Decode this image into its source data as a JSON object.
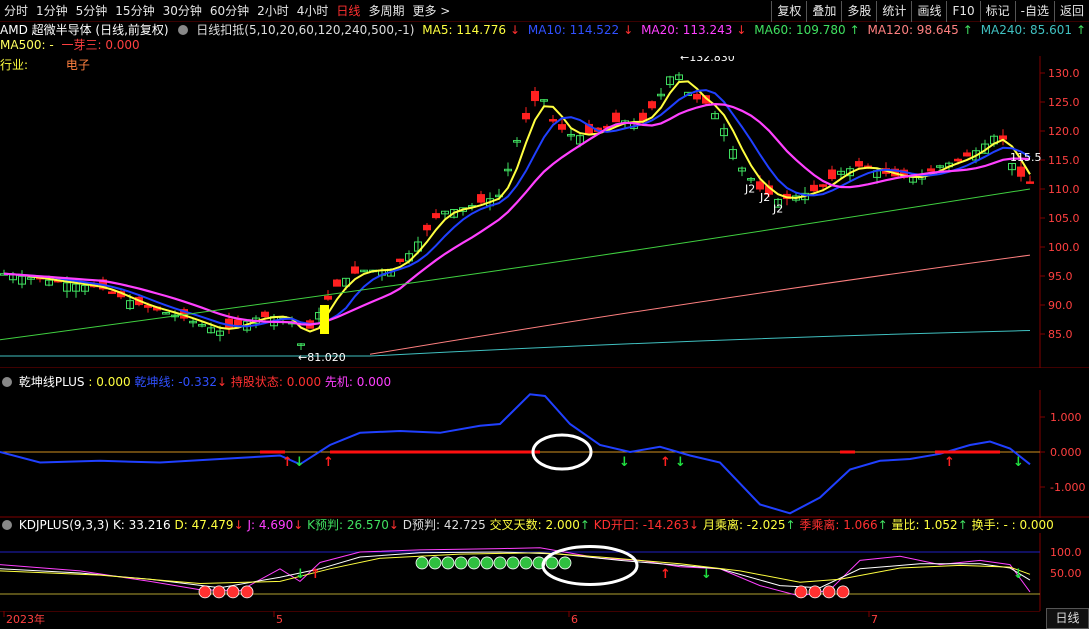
{
  "periods": [
    "分时",
    "1分钟",
    "5分钟",
    "15分钟",
    "30分钟",
    "60分钟",
    "2小时",
    "4小时",
    "日线",
    "多周期",
    "更多 >"
  ],
  "active_period": "日线",
  "tools": [
    "复权",
    "叠加",
    "多股",
    "统计",
    "画线",
    "F10",
    "标记",
    "-自选",
    "返回"
  ],
  "main": {
    "stock": "AMD 超微半导体 (日线,前复权)",
    "indicator": "日线扣抵(5,10,20,60,120,240,500,-1)",
    "ma5": "MA5: 114.776",
    "ma10": "MA10: 114.522",
    "ma20": "MA20: 113.243",
    "ma60": "MA60: 109.780",
    "ma120": "MA120: 98.645",
    "ma240": "MA240: 85.601",
    "ma500": "MA500: -",
    "yiya": "一芽三: 0.000",
    "industry_label": "行业:",
    "industry_value": "电子",
    "high_mark": "132.830",
    "low_mark": "81.020",
    "last_mark": "115.5",
    "j2": [
      "J2",
      "J2",
      "J2"
    ],
    "yticks": [
      "130.0",
      "125.0",
      "120.0",
      "115.0",
      "110.0",
      "105.0",
      "100.0",
      "95.0",
      "90.0",
      "85.0"
    ]
  },
  "pane2": {
    "name": "乾坤线PLUS",
    "v0": ": 0.000",
    "qk": "乾坤线: -0.332",
    "hold": "持股状态: 0.000",
    "xianji": "先机: 0.000",
    "yticks": [
      "1.000",
      "0.000",
      "-1.000"
    ]
  },
  "pane3": {
    "name": "KDJPLUS(9,3,3)",
    "k": "K: 33.216",
    "d": "D: 47.479",
    "j": "J: 4.690",
    "kpre": "K预判: 26.570",
    "dpre": "D预判: 42.725",
    "cross": "交叉天数: 2.000",
    "kdopen": "KD开口: -14.263",
    "monthdev": "月乘离: -2.025",
    "seasondev": "季乘离: 1.066",
    "volratio": "量比: 1.052",
    "turnover": "换手: - : 0.000",
    "yticks": [
      "100.0",
      "50.00"
    ]
  },
  "xaxis": [
    "2023年",
    "5",
    "6",
    "7"
  ],
  "bottom_tab": "日线",
  "colors": {
    "ma5": "#ffff40",
    "ma10": "#2040ff",
    "ma20": "#ff40ff",
    "ma60": "#40d040",
    "ma120": "#ff8080",
    "ma240": "#40c0c0",
    "up": "#40e060",
    "down": "#ff2020"
  }
}
